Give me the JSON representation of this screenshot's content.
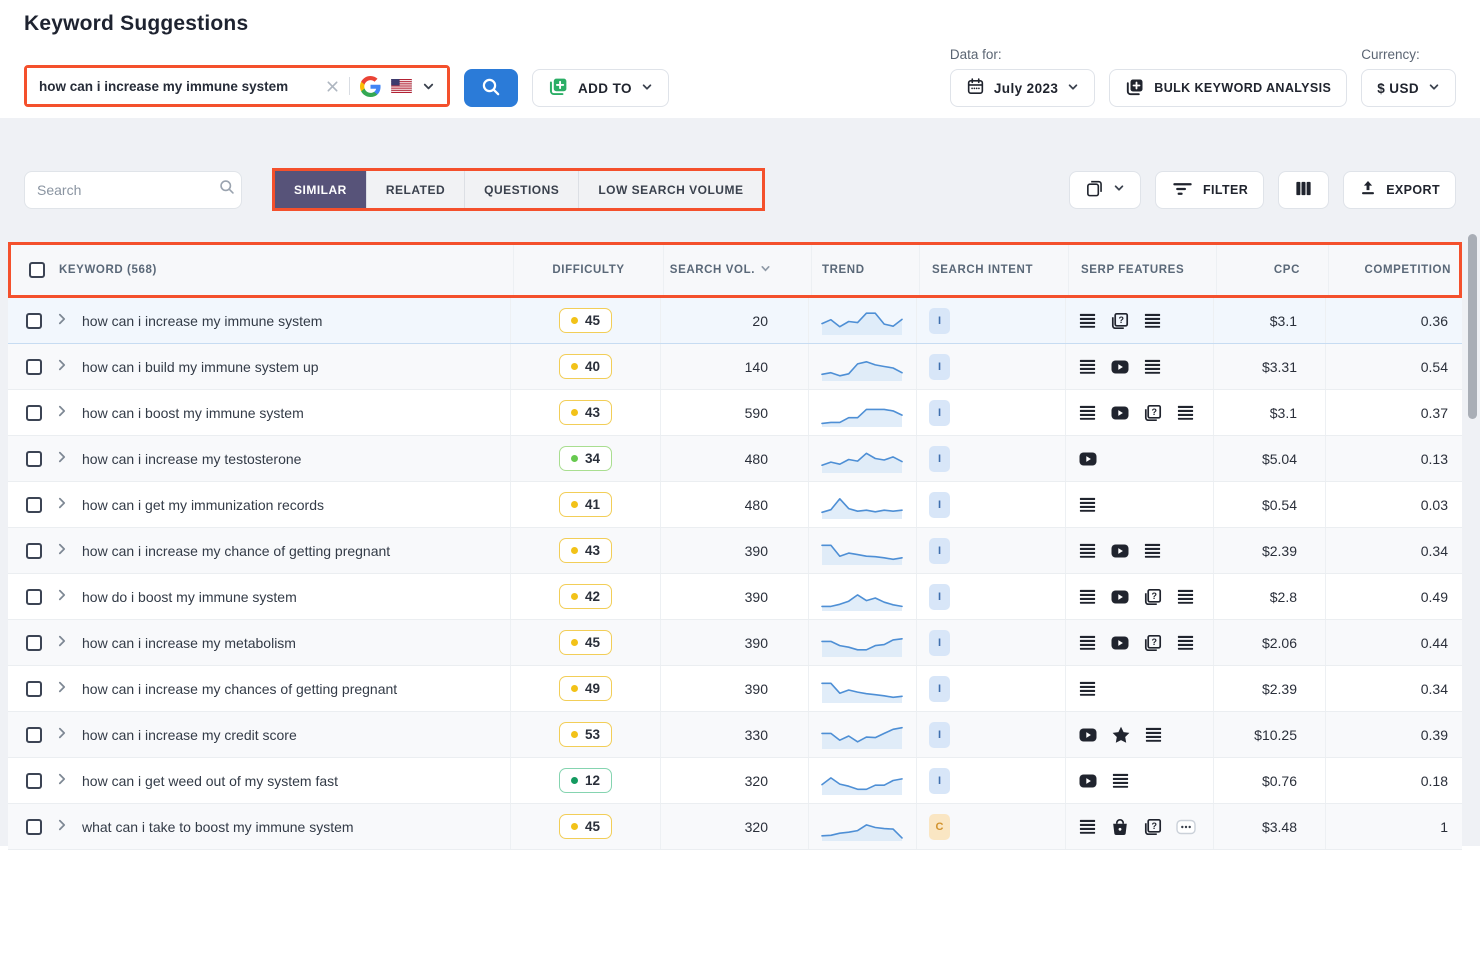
{
  "page_title": "Keyword Suggestions",
  "colors": {
    "annotation_red": "#F4502C",
    "primary_blue": "#2B7BD8",
    "tab_active_bg": "#575379",
    "panel_bg": "#EFF1F5",
    "sparkline_line": "#4E8FD5",
    "sparkline_fill": "#DAE8F8"
  },
  "header": {
    "search": {
      "value": "how can i increase my immune system",
      "engine": "google",
      "region": "united-states"
    },
    "add_to_label": "ADD TO",
    "data_for_label": "Data for:",
    "date_value": "July 2023",
    "bulk_label": "BULK KEYWORD ANALYSIS",
    "currency_label": "Currency:",
    "currency_value": "$ USD"
  },
  "toolbar": {
    "search_placeholder": "Search",
    "tabs": [
      {
        "label": "SIMILAR",
        "active": true
      },
      {
        "label": "RELATED",
        "active": false
      },
      {
        "label": "QUESTIONS",
        "active": false
      },
      {
        "label": "LOW SEARCH VOLUME",
        "active": false
      }
    ],
    "filter_label": "FILTER",
    "export_label": "EXPORT"
  },
  "table": {
    "columns": [
      "KEYWORD (568)",
      "DIFFICULTY",
      "SEARCH VOL.",
      "TREND",
      "SEARCH INTENT",
      "SERP FEATURES",
      "CPC",
      "COMPETITION"
    ],
    "rows": [
      {
        "keyword": "how can i increase my immune system",
        "difficulty": "45",
        "difficulty_level": "yellow",
        "volume": "20",
        "intent": "I",
        "serp_features": [
          "featured-snippet",
          "people-also-ask",
          "featured-snippet"
        ],
        "cpc": "$3.1",
        "competition": "0.36",
        "trend": [
          40,
          55,
          28,
          48,
          44,
          80,
          80,
          38,
          30,
          56
        ],
        "highlighted": true
      },
      {
        "keyword": "how can i build my immune system up",
        "difficulty": "40",
        "difficulty_level": "yellow",
        "volume": "140",
        "intent": "I",
        "serp_features": [
          "featured-snippet",
          "video",
          "featured-snippet"
        ],
        "cpc": "$3.31",
        "competition": "0.54",
        "trend": [
          22,
          28,
          16,
          24,
          62,
          70,
          58,
          52,
          46,
          28
        ],
        "highlighted": false
      },
      {
        "keyword": "how can i boost my immune system",
        "difficulty": "43",
        "difficulty_level": "yellow",
        "volume": "590",
        "intent": "I",
        "serp_features": [
          "featured-snippet",
          "video",
          "people-also-ask",
          "featured-snippet"
        ],
        "cpc": "$3.1",
        "competition": "0.37",
        "trend": [
          10,
          14,
          14,
          32,
          32,
          64,
          64,
          64,
          58,
          42
        ],
        "highlighted": false
      },
      {
        "keyword": "how can i increase my testosterone",
        "difficulty": "34",
        "difficulty_level": "green",
        "volume": "480",
        "intent": "I",
        "serp_features": [
          "video"
        ],
        "cpc": "$5.04",
        "competition": "0.13",
        "trend": [
          26,
          38,
          30,
          48,
          42,
          72,
          52,
          46,
          58,
          40
        ],
        "highlighted": false
      },
      {
        "keyword": "how can i get my immunization records",
        "difficulty": "41",
        "difficulty_level": "yellow",
        "volume": "480",
        "intent": "I",
        "serp_features": [
          "featured-snippet"
        ],
        "cpc": "$0.54",
        "competition": "0.03",
        "trend": [
          22,
          32,
          74,
          36,
          26,
          30,
          24,
          30,
          26,
          30
        ],
        "highlighted": false
      },
      {
        "keyword": "how can i increase my chance of getting pregnant",
        "difficulty": "43",
        "difficulty_level": "yellow",
        "volume": "390",
        "intent": "I",
        "serp_features": [
          "featured-snippet",
          "video",
          "featured-snippet"
        ],
        "cpc": "$2.39",
        "competition": "0.34",
        "trend": [
          72,
          72,
          30,
          42,
          36,
          30,
          28,
          24,
          18,
          24
        ],
        "highlighted": false
      },
      {
        "keyword": "how do i boost my immune system",
        "difficulty": "42",
        "difficulty_level": "yellow",
        "volume": "390",
        "intent": "I",
        "serp_features": [
          "featured-snippet",
          "video",
          "people-also-ask",
          "featured-snippet"
        ],
        "cpc": "$2.8",
        "competition": "0.49",
        "trend": [
          14,
          14,
          22,
          34,
          58,
          36,
          46,
          30,
          20,
          14
        ],
        "highlighted": false
      },
      {
        "keyword": "how can i increase my metabolism",
        "difficulty": "45",
        "difficulty_level": "yellow",
        "volume": "390",
        "intent": "I",
        "serp_features": [
          "featured-snippet",
          "video",
          "people-also-ask",
          "featured-snippet"
        ],
        "cpc": "$2.06",
        "competition": "0.44",
        "trend": [
          56,
          56,
          40,
          34,
          24,
          24,
          40,
          44,
          62,
          66
        ],
        "highlighted": false
      },
      {
        "keyword": "how can i increase my chances of getting pregnant",
        "difficulty": "49",
        "difficulty_level": "yellow",
        "volume": "390",
        "intent": "I",
        "serp_features": [
          "featured-snippet"
        ],
        "cpc": "$2.39",
        "competition": "0.34",
        "trend": [
          72,
          72,
          34,
          46,
          38,
          32,
          28,
          24,
          18,
          22
        ],
        "highlighted": false
      },
      {
        "keyword": "how can i increase my credit score",
        "difficulty": "53",
        "difficulty_level": "yellow",
        "volume": "330",
        "intent": "I",
        "serp_features": [
          "video",
          "reviews",
          "featured-snippet"
        ],
        "cpc": "$10.25",
        "competition": "0.39",
        "trend": [
          56,
          56,
          30,
          46,
          24,
          42,
          40,
          56,
          72,
          78
        ],
        "highlighted": false
      },
      {
        "keyword": "how can i get weed out of my system fast",
        "difficulty": "12",
        "difficulty_level": "teal",
        "volume": "320",
        "intent": "I",
        "serp_features": [
          "video",
          "featured-snippet"
        ],
        "cpc": "$0.76",
        "competition": "0.18",
        "trend": [
          36,
          62,
          38,
          30,
          18,
          18,
          34,
          34,
          52,
          58
        ],
        "highlighted": false
      },
      {
        "keyword": "what can i take to boost my immune system",
        "difficulty": "45",
        "difficulty_level": "yellow",
        "volume": "320",
        "intent": "C",
        "serp_features": [
          "featured-snippet",
          "shopping",
          "people-also-ask",
          "more"
        ],
        "cpc": "$3.48",
        "competition": "1",
        "trend": [
          16,
          18,
          26,
          30,
          36,
          58,
          48,
          44,
          42,
          8
        ],
        "highlighted": false
      }
    ]
  }
}
